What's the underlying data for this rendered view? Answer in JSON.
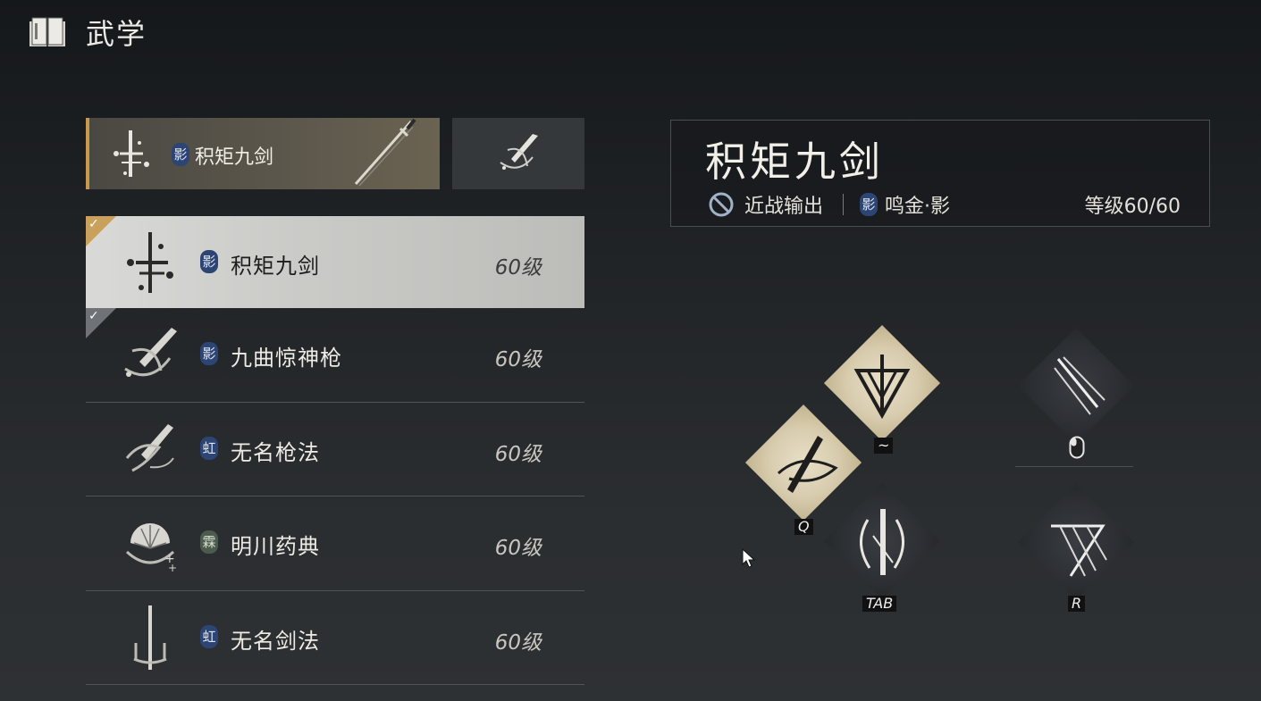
{
  "header": {
    "title": "武学",
    "icon": "book-icon"
  },
  "equipped": {
    "badge": "影",
    "name": "积矩九剑",
    "weapon_icon": "sword-icon",
    "sub_slot_icon": "spear-emblem-icon"
  },
  "arts": [
    {
      "badge": "影",
      "name": "积矩九剑",
      "level": "60级",
      "selected": true,
      "checked": true,
      "icon": "sword-emblem-icon"
    },
    {
      "badge": "影",
      "name": "九曲惊神枪",
      "level": "60级",
      "selected": false,
      "checked": true,
      "icon": "spear-emblem-icon"
    },
    {
      "badge": "虹",
      "name": "无名枪法",
      "level": "60级",
      "selected": false,
      "checked": false,
      "icon": "spear-swirl-icon"
    },
    {
      "badge": "霖",
      "name": "明川药典",
      "level": "60级",
      "selected": false,
      "checked": false,
      "icon": "fan-emblem-icon"
    },
    {
      "badge": "虹",
      "name": "无名剑法",
      "level": "60级",
      "selected": false,
      "checked": false,
      "icon": "blade-emblem-icon"
    }
  ],
  "detail": {
    "title": "积矩九剑",
    "role_icon": "ban-icon",
    "role": "近战输出",
    "school_badge": "影",
    "school": "鸣金·影",
    "level": "等级60/60"
  },
  "skills": {
    "tilde": {
      "key": "~",
      "icon": "tri-blade-icon"
    },
    "q": {
      "key": "Q",
      "icon": "sword-slash-icon"
    },
    "tab": {
      "key": "TAB",
      "icon": "crescent-blade-icon"
    },
    "mouse": {
      "key_icon": "mouse-icon",
      "icon": "triple-streak-icon"
    },
    "r": {
      "key": "R",
      "icon": "sword-rain-icon"
    }
  },
  "colors": {
    "accent_gold": "#c8994d",
    "badge_blue": "#2d4574",
    "badge_green": "#4d5b4e",
    "selected_row": "#d9d9d7",
    "skill_light": "#e7dfc8"
  }
}
